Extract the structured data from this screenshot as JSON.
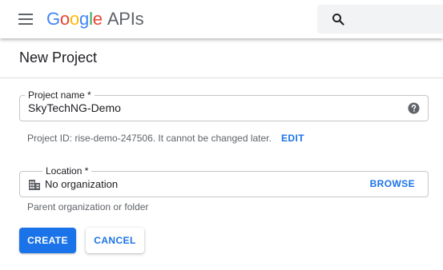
{
  "header": {
    "logo": {
      "G": "G",
      "o1": "o",
      "o2": "o",
      "g": "g",
      "l": "l",
      "e": "e",
      "product": "APIs"
    },
    "search": {
      "placeholder": "",
      "value": ""
    }
  },
  "page": {
    "title": "New Project"
  },
  "project_name": {
    "label": "Project name *",
    "value": "SkyTechNG-Demo",
    "project_id_hint": "Project ID: rise-demo-247506. It cannot be changed later.",
    "edit_label": "EDIT"
  },
  "location": {
    "label": "Location *",
    "value": "No organization",
    "browse_label": "BROWSE",
    "hint": "Parent organization or folder"
  },
  "actions": {
    "create_label": "CREATE",
    "cancel_label": "CANCEL"
  },
  "colors": {
    "primary": "#1a73e8",
    "google_blue": "#4285F4",
    "google_red": "#EA4335",
    "google_yellow": "#FBBC05",
    "google_green": "#34A853"
  },
  "icons": [
    "menu-icon",
    "search-icon",
    "help-icon",
    "organization-icon"
  ]
}
